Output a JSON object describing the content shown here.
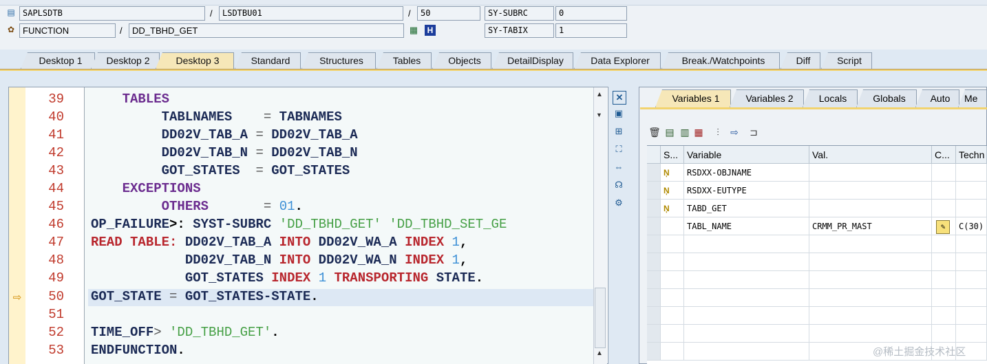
{
  "info": {
    "row1": {
      "program": "SAPLSDTB",
      "include": "LSDTBU01",
      "line": "50",
      "sysvar": "SY-SUBRC",
      "sysval": "0"
    },
    "row2": {
      "type": "FUNCTION",
      "name": "DD_TBHD_GET",
      "sysvar": "SY-TABIX",
      "sysval": "1"
    }
  },
  "tabs": [
    "Desktop 1",
    "Desktop 2",
    "Desktop 3",
    "Standard",
    "Structures",
    "Tables",
    "Objects",
    "DetailDisplay",
    "Data Explorer",
    "Break./Watchpoints",
    "Diff",
    "Script"
  ],
  "active_tab": "Desktop 3",
  "code": {
    "line_numbers": [
      "39",
      "40",
      "41",
      "42",
      "43",
      "44",
      "45",
      "46",
      "47",
      "48",
      "49",
      "50",
      "51",
      "52",
      "53"
    ],
    "current_line": "50"
  },
  "right_tabs": [
    "Variables 1",
    "Variables 2",
    "Locals",
    "Globals",
    "Auto",
    "Me"
  ],
  "variables": {
    "headers": [
      "S...",
      "Variable",
      "Val.",
      "C...",
      "Techn"
    ],
    "rows": [
      {
        "variable": "RSDXX-OBJNAME",
        "value": "",
        "tech": ""
      },
      {
        "variable": "RSDXX-EUTYPE",
        "value": "",
        "tech": ""
      },
      {
        "variable": "TABD_GET",
        "value": "",
        "tech": ""
      },
      {
        "variable": "TABL_NAME",
        "value": "CRMM_PR_MAST",
        "tech": "C(30)"
      }
    ]
  },
  "watermark": "@稀土掘金技术社区"
}
